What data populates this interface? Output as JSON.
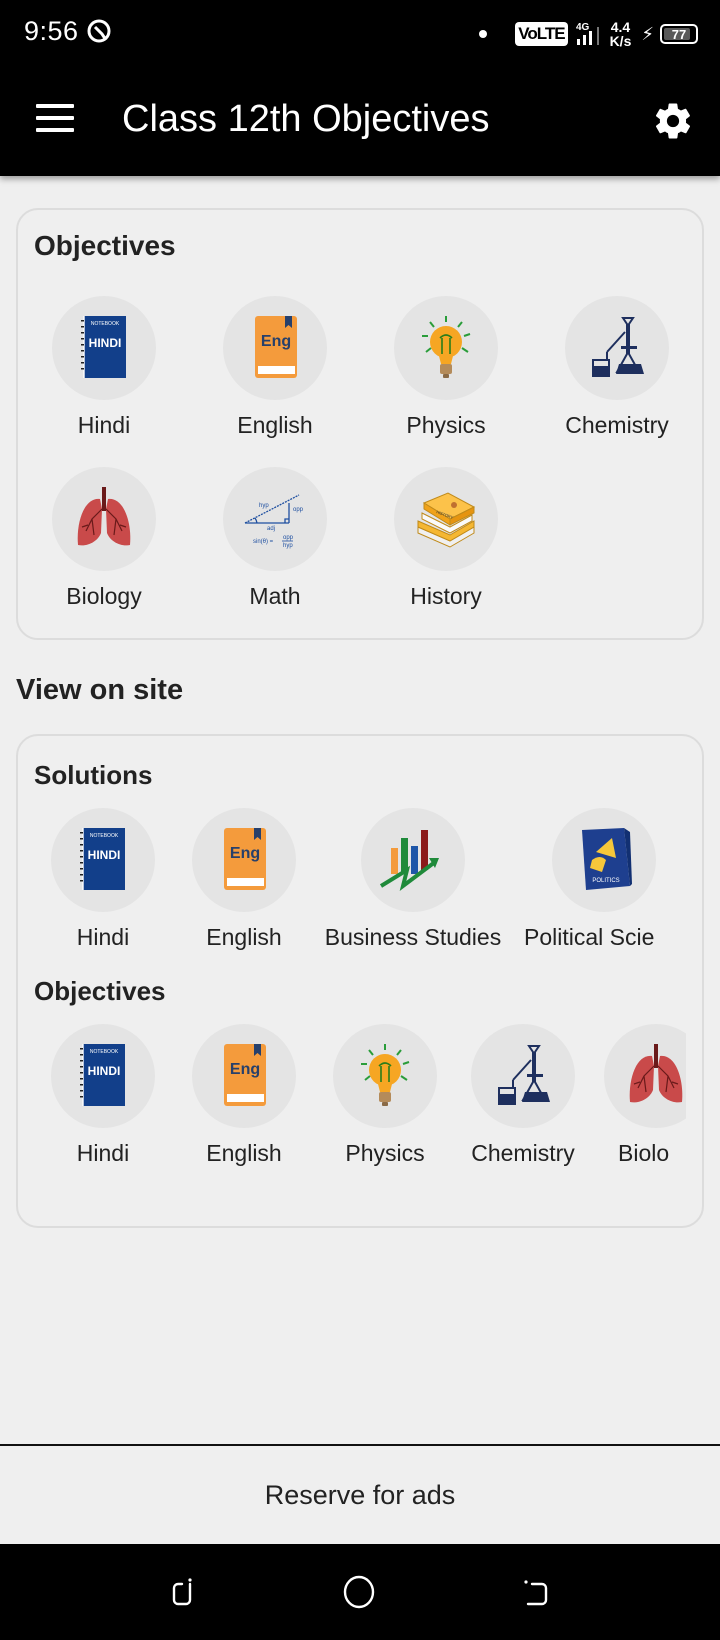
{
  "status_bar": {
    "time": "9:56",
    "network_badge": "VoLTE",
    "network_type": "4G",
    "speed_value": "4.4",
    "speed_unit": "K/s",
    "battery_level": "77"
  },
  "app_bar": {
    "title": "Class 12th Objectives",
    "menu_icon": "hamburger-menu-icon",
    "settings_icon": "gear-icon"
  },
  "objectives_card": {
    "title": "Objectives",
    "items": [
      {
        "label": "Hindi",
        "icon": "hindi-notebook-icon"
      },
      {
        "label": "English",
        "icon": "english-book-icon"
      },
      {
        "label": "Physics",
        "icon": "lightbulb-icon"
      },
      {
        "label": "Chemistry",
        "icon": "lab-flask-icon"
      },
      {
        "label": "Biology",
        "icon": "lungs-icon"
      },
      {
        "label": "Math",
        "icon": "trigonometry-icon"
      },
      {
        "label": "History",
        "icon": "history-books-icon"
      }
    ]
  },
  "view_on_site": {
    "title": "View on site",
    "solutions": {
      "title": "Solutions",
      "items": [
        {
          "label": "Hindi",
          "icon": "hindi-notebook-icon"
        },
        {
          "label": "English",
          "icon": "english-book-icon"
        },
        {
          "label": "Business Studies",
          "icon": "growth-chart-icon"
        },
        {
          "label": "Political Scie",
          "icon": "politics-book-icon"
        }
      ]
    },
    "objectives": {
      "title": "Objectives",
      "items": [
        {
          "label": "Hindi",
          "icon": "hindi-notebook-icon"
        },
        {
          "label": "English",
          "icon": "english-book-icon"
        },
        {
          "label": "Physics",
          "icon": "lightbulb-icon"
        },
        {
          "label": "Chemistry",
          "icon": "lab-flask-icon"
        },
        {
          "label": "Biolo",
          "icon": "lungs-icon"
        }
      ]
    }
  },
  "ad_banner": {
    "text": "Reserve for ads"
  },
  "icon_text": {
    "notebook": "NOTEBOOK",
    "hindi": "HINDI",
    "eng": "Eng",
    "politics": "POLITICS"
  },
  "colors": {
    "app_bar_bg": "#000000",
    "page_bg": "#efefef",
    "circle_bg": "#e4e4e4",
    "hindi_blue": "#123f8a",
    "english_orange": "#f49b3c",
    "lungs_red": "#c94a4a"
  }
}
